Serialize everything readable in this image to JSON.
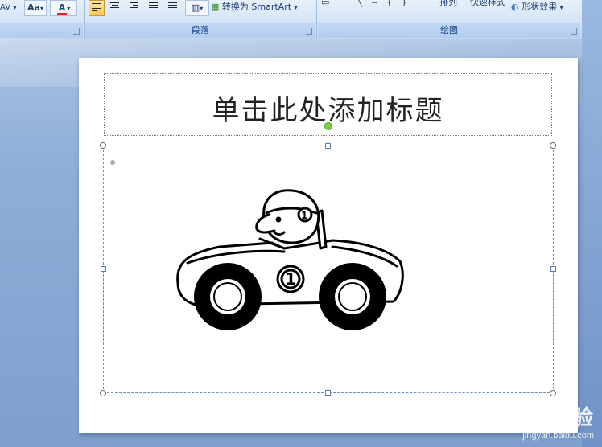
{
  "ribbon": {
    "font_group": {
      "char_spacing_label": "AV",
      "change_case_label": "Aa",
      "font_color_label": "A",
      "font_color_hex": "#e0201a"
    },
    "paragraph_group": {
      "label": "段落",
      "smartart_label": "转换为 SmartArt"
    },
    "drawing_group": {
      "label": "绘图",
      "arrange_label": "排列",
      "quick_styles_label": "快速样式",
      "shape_effects_label": "形状效果"
    }
  },
  "slide": {
    "title_placeholder": "单击此处添加标题",
    "content_image": "race-car-clipart"
  },
  "watermark": {
    "logo": "Bai 经验",
    "url": "jingyan.baidu.com"
  },
  "colors": {
    "ribbon_label": "#15428b",
    "selection_border": "#6f8fb5",
    "rotate_handle": "#7ccf45"
  }
}
